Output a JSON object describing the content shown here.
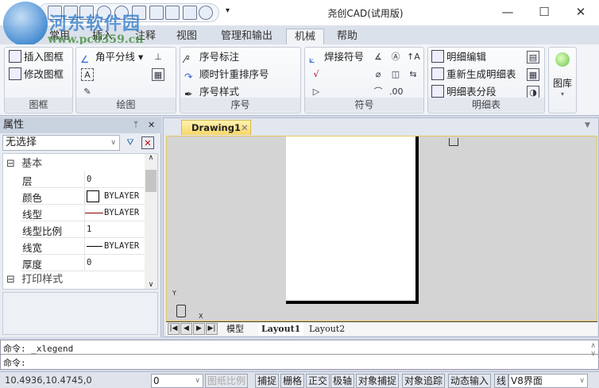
{
  "window": {
    "title": "尧创CAD(试用版)",
    "minimize": "—",
    "maximize": "☐",
    "close": "✕",
    "qat_more": "▾"
  },
  "watermark": {
    "name": "河东软件园",
    "url": "www.pc0359.cn"
  },
  "tabs": [
    {
      "label": "常用"
    },
    {
      "label": "插入"
    },
    {
      "label": "注释"
    },
    {
      "label": "视图"
    },
    {
      "label": "管理和输出"
    },
    {
      "label": "机械",
      "active": true
    },
    {
      "label": "帮助"
    }
  ],
  "ribbon": {
    "frame": {
      "label": "图框",
      "items": [
        "插入图框",
        "修改图框"
      ]
    },
    "draw": {
      "label": "绘图",
      "items": [
        "角平分线"
      ]
    },
    "serial": {
      "label": "序号",
      "items": [
        "序号标注",
        "顺时针重排序号",
        "序号样式"
      ]
    },
    "symbol": {
      "label": "符号",
      "items": [
        "焊接符号"
      ]
    },
    "bom": {
      "label": "明细表",
      "items": [
        "明细编辑",
        "重新生成明细表",
        "明细表分段"
      ]
    },
    "library": {
      "label": "图库"
    }
  },
  "properties": {
    "title": "属性",
    "selection": "无选择",
    "section": "基本",
    "next_section": "打印样式",
    "rows": [
      {
        "key": "层",
        "value": "0"
      },
      {
        "key": "颜色",
        "value": "BYLAYER"
      },
      {
        "key": "线型",
        "value": "BYLAYER"
      },
      {
        "key": "线型比例",
        "value": "1"
      },
      {
        "key": "线宽",
        "value": "BYLAYER"
      },
      {
        "key": "厚度",
        "value": "0"
      }
    ]
  },
  "drawing": {
    "tab": "Drawing1",
    "layouts": [
      "模型",
      "Layout1",
      "Layout2"
    ],
    "active_layout": "Layout1",
    "ucs_y": "Y",
    "ucs_x": "X"
  },
  "command": {
    "line1": "命令: _xlegend",
    "line2": "命令:"
  },
  "status": {
    "coords": "10.4936,10.4745,0",
    "layer": "0",
    "buttons": [
      "图纸比例",
      "捕捉",
      "栅格",
      "正交",
      "极轴",
      "对象捕捉",
      "对象追踪",
      "动态输入",
      "线"
    ],
    "ui": "V8界面"
  }
}
